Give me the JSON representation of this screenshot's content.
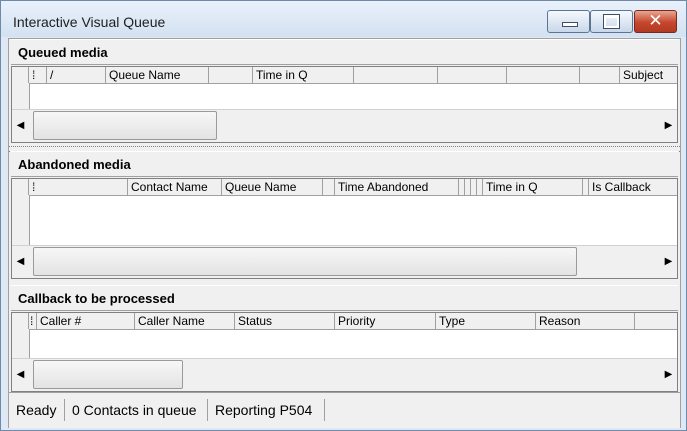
{
  "window": {
    "title": "Interactive Visual Queue"
  },
  "titlebar_buttons": {
    "minimize": "minimize-icon",
    "maximize": "maximize-icon",
    "close": "✕"
  },
  "queued": {
    "title": "Queued media",
    "columns": [
      "",
      "/",
      "",
      "Queue Name",
      "",
      "Time in Q",
      "",
      "",
      "",
      "",
      "Subject"
    ]
  },
  "abandoned": {
    "title": "Abandoned media",
    "columns": [
      "",
      "Contact Name",
      "Queue Name",
      "",
      "Time Abandoned",
      "",
      "Time in Q",
      "",
      "Is Callback"
    ]
  },
  "callback": {
    "title": "Callback to be processed",
    "columns": [
      "Caller #",
      "Caller Name",
      "Status",
      "Priority",
      "Type",
      "Reason",
      ""
    ]
  },
  "scroll": {
    "left": "◀",
    "right": "▶"
  },
  "status": {
    "ready": "Ready",
    "contacts": "0 Contacts in queue",
    "reporting": "Reporting P504"
  },
  "colors": {
    "accent_close": "#c5462d",
    "titlebar": "#dfe9f5"
  }
}
